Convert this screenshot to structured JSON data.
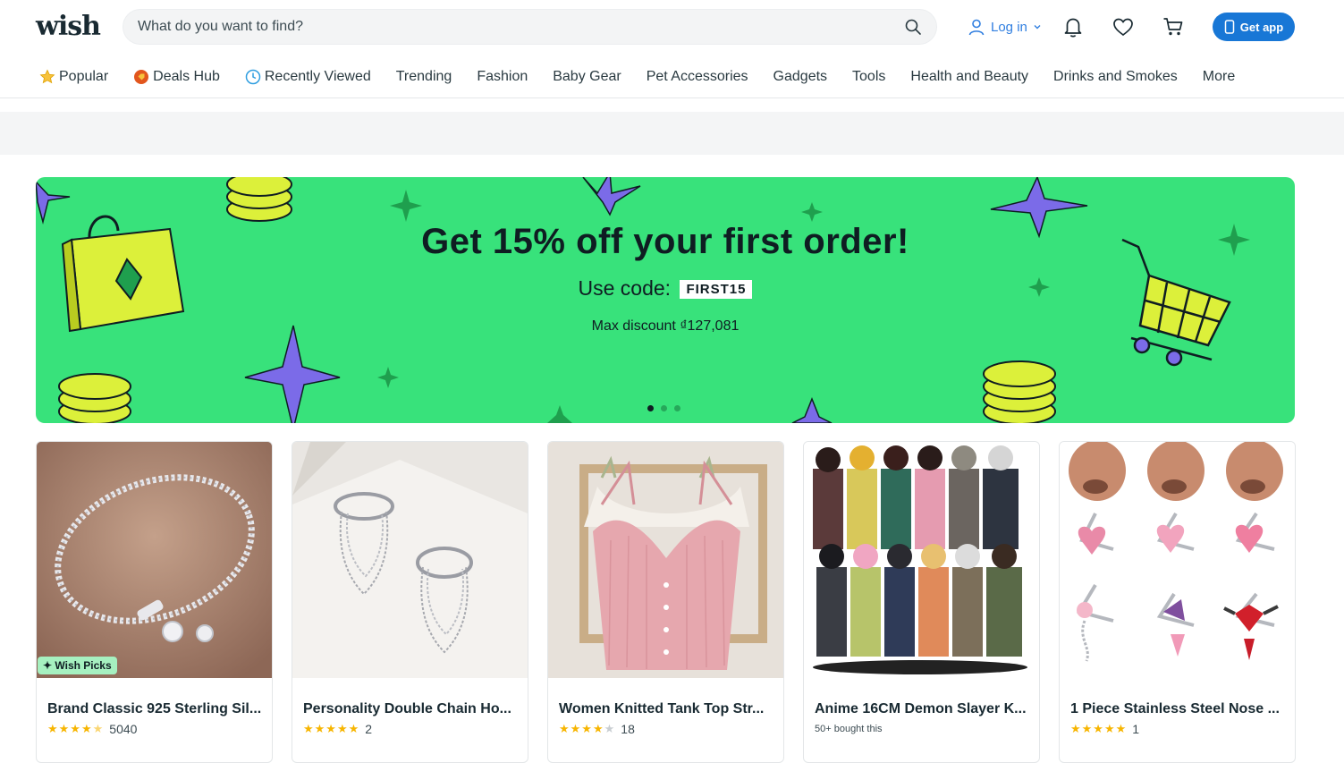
{
  "header": {
    "logo": "wish",
    "search_placeholder": "What do you want to find?",
    "login_label": "Log in",
    "get_app_label": "Get app"
  },
  "nav": {
    "items": [
      {
        "label": "Popular",
        "icon": "star-icon"
      },
      {
        "label": "Deals Hub",
        "icon": "deals-tag-icon"
      },
      {
        "label": "Recently Viewed",
        "icon": "clock-icon"
      },
      {
        "label": "Trending"
      },
      {
        "label": "Fashion"
      },
      {
        "label": "Baby Gear"
      },
      {
        "label": "Pet Accessories"
      },
      {
        "label": "Gadgets"
      },
      {
        "label": "Tools"
      },
      {
        "label": "Health and Beauty"
      },
      {
        "label": "Drinks and Smokes"
      },
      {
        "label": "More"
      }
    ]
  },
  "banner": {
    "title": "Get 15% off your first order!",
    "code_prefix": "Use code:",
    "code": "FIRST15",
    "max_discount": "Max discount ₫127,081",
    "slide_count": 3,
    "active_slide": 1,
    "bg_color": "#38e27b"
  },
  "products": [
    {
      "title": "Brand Classic 925 Sterling Sil...",
      "rating": 4.5,
      "reviews": "5040",
      "badge": "✦ Wish Picks"
    },
    {
      "title": "Personality Double Chain Ho...",
      "rating": 5,
      "reviews": "2"
    },
    {
      "title": "Women Knitted Tank Top Str...",
      "rating": 4,
      "reviews": "18"
    },
    {
      "title": "Anime 16CM Demon Slayer K...",
      "sold": "50+ bought this"
    },
    {
      "title": "1 Piece Stainless Steel Nose ...",
      "rating": 5,
      "reviews": "1"
    }
  ]
}
